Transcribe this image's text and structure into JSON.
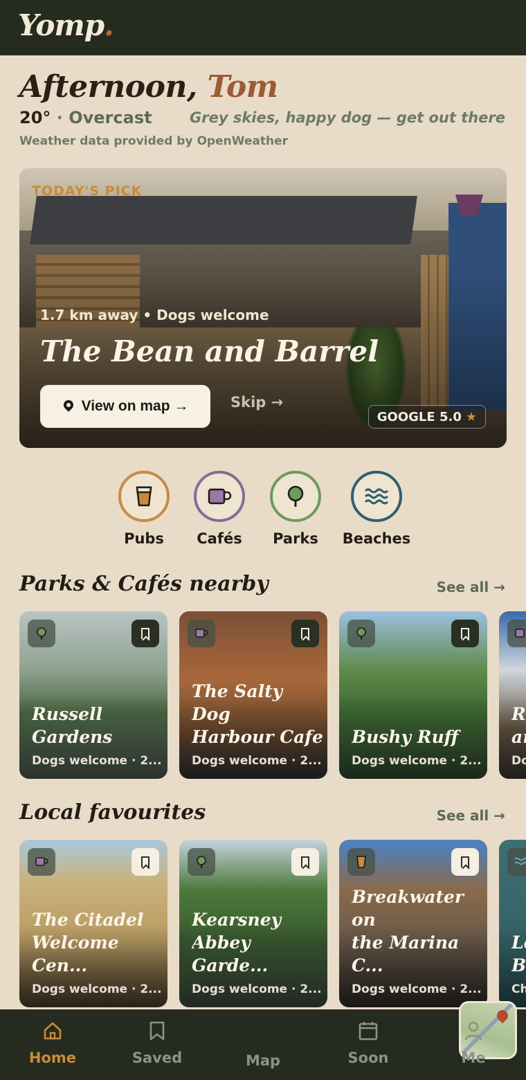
{
  "app": {
    "logo": "Yomp",
    "logo_dot": "."
  },
  "greeting": {
    "prefix": "Afternoon,",
    "name": "Tom"
  },
  "weather": {
    "temp": "20°",
    "sep": " · ",
    "condition": "Overcast",
    "tagline": "Grey skies, happy dog — get out there",
    "provider": "Weather data provided by OpenWeather"
  },
  "hero": {
    "badge": "TODAY'S PICK",
    "distance": "1.7 km away",
    "dogs": "Dogs welcome",
    "title": "The Bean and Barrel",
    "map_button": "View on map →",
    "skip": "Skip →",
    "rating": "GOOGLE 5.0",
    "star": "★"
  },
  "categories": [
    {
      "label": "Pubs",
      "icon": "pint-icon",
      "color": "#c58a4a"
    },
    {
      "label": "Cafés",
      "icon": "coffee-cup-icon",
      "color": "#8a6a96"
    },
    {
      "label": "Parks",
      "icon": "tree-icon",
      "color": "#6f9a5a"
    },
    {
      "label": "Beaches",
      "icon": "waves-icon",
      "color": "#2e5f70"
    }
  ],
  "nearby": {
    "title": "Parks & Cafés nearby",
    "see_all": "See all →",
    "cards": [
      {
        "name": "Russell\nGardens",
        "sub": "Dogs welcome · 2...",
        "icon": "tree-icon"
      },
      {
        "name": "The Salty Dog\nHarbour Cafe",
        "sub": "Dogs welcome · 2...",
        "icon": "coffee-cup-icon"
      },
      {
        "name": "Bushy Ruff",
        "sub": "Dogs welcome · 2...",
        "icon": "tree-icon"
      },
      {
        "name": "Ro\nan",
        "sub": "Do",
        "icon": "coffee-cup-icon"
      }
    ]
  },
  "favourites": {
    "title": "Local favourites",
    "see_all": "See all →",
    "cards": [
      {
        "name": "The Citadel\nWelcome Cen...",
        "sub": "Dogs welcome · 2...",
        "icon": "coffee-cup-icon"
      },
      {
        "name": "Kearsney\nAbbey Garde...",
        "sub": "Dogs welcome · 2...",
        "icon": "tree-icon"
      },
      {
        "name": "Breakwater on\nthe Marina C...",
        "sub": "Dogs welcome · 2...",
        "icon": "pint-icon"
      },
      {
        "name": "Le\nBe",
        "sub": "Ch",
        "icon": "waves-icon"
      }
    ]
  },
  "nav": [
    {
      "label": "Home",
      "icon": "home-icon"
    },
    {
      "label": "Saved",
      "icon": "bookmark-icon"
    },
    {
      "label": "Map",
      "icon": "map-icon"
    },
    {
      "label": "Soon",
      "icon": "calendar-icon"
    },
    {
      "label": "Me",
      "icon": "user-icon"
    }
  ]
}
